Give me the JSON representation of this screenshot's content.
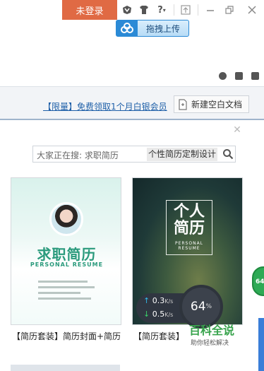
{
  "topbar": {
    "login_label": "未登录",
    "icons": [
      "app-icon",
      "skin-icon",
      "help-icon",
      "mini-mode-icon",
      "minimize-icon",
      "restore-icon",
      "close-icon"
    ],
    "help_label": "?",
    "upload_label": "拖拽上传"
  },
  "toolbar": {
    "vip_link": "【限量】免费领取1个月白银会员",
    "new_doc_label": "新建空白文档"
  },
  "search": {
    "placeholder": "大家正在搜: 求职简历",
    "tag": "个性简历定制设计"
  },
  "cards": [
    {
      "title": "求职简历",
      "subtitle": "PERSONAL RESUME",
      "caption": "【简历套装】简历封面+简历"
    },
    {
      "title": "个人简历",
      "subtitle": "PERSONAL RESUME",
      "caption": "【简历套装】"
    }
  ],
  "speed": {
    "upload": "0.3",
    "download": "0.5",
    "unit": "K/s",
    "percent": "64",
    "percent_sign": "%",
    "ball_value": "64"
  },
  "watermark": {
    "title": "百科全说",
    "subtitle": "助你轻松解决"
  },
  "colors": {
    "login_bg": "#e06a44",
    "accent_blue": "#2b8ad6",
    "link": "#1e5fa8",
    "speed_bg": "#303641",
    "ball_green": "#2eaa55",
    "card1_text": "#2a9a7c"
  }
}
